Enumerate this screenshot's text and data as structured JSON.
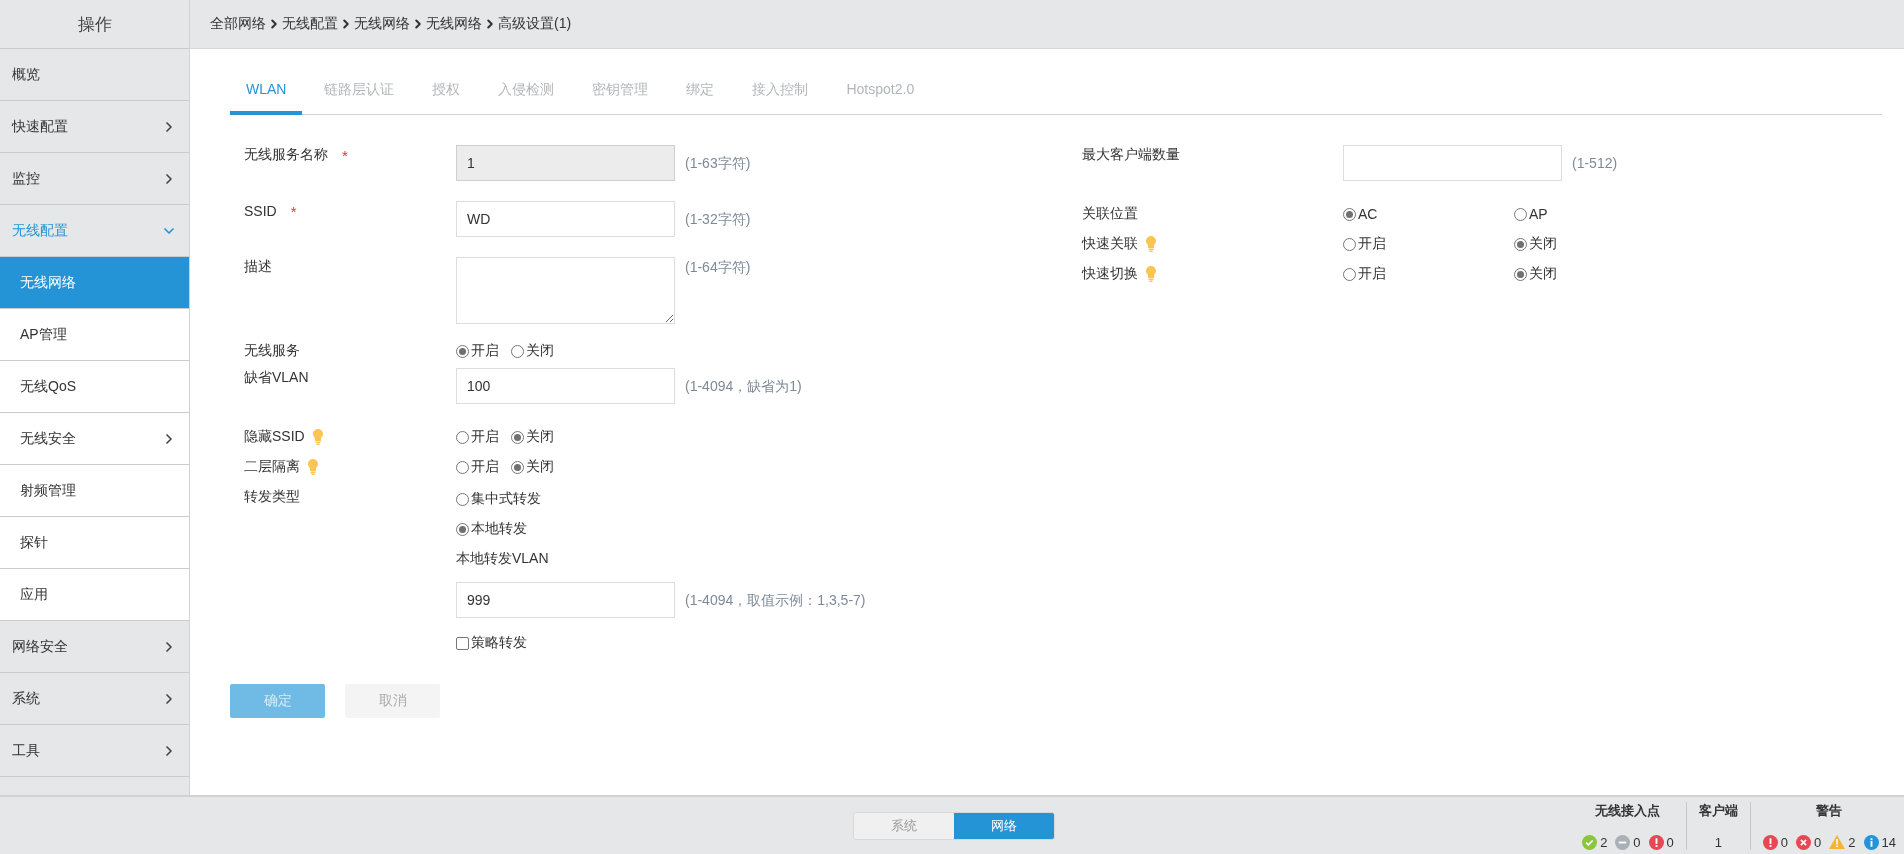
{
  "sidebar": {
    "title": "操作",
    "items": [
      {
        "label": "概览",
        "expandable": false,
        "expanded": false,
        "selected": false
      },
      {
        "label": "快速配置",
        "expandable": true,
        "expanded": false,
        "selected": false
      },
      {
        "label": "监控",
        "expandable": true,
        "expanded": false,
        "selected": false
      },
      {
        "label": "无线配置",
        "expandable": true,
        "expanded": true,
        "selected": false,
        "children": [
          {
            "label": "无线网络",
            "expandable": false,
            "expanded": false,
            "selected": true
          },
          {
            "label": "AP管理",
            "expandable": false,
            "expanded": false,
            "selected": false
          },
          {
            "label": "无线QoS",
            "expandable": false,
            "expanded": false,
            "selected": false
          },
          {
            "label": "无线安全",
            "expandable": true,
            "expanded": false,
            "selected": false
          },
          {
            "label": "射频管理",
            "expandable": false,
            "expanded": false,
            "selected": false
          },
          {
            "label": "探针",
            "expandable": false,
            "expanded": false,
            "selected": false
          },
          {
            "label": "应用",
            "expandable": false,
            "expanded": false,
            "selected": false
          }
        ]
      },
      {
        "label": "网络安全",
        "expandable": true,
        "expanded": false,
        "selected": false
      },
      {
        "label": "系统",
        "expandable": true,
        "expanded": false,
        "selected": false
      },
      {
        "label": "工具",
        "expandable": true,
        "expanded": false,
        "selected": false
      }
    ]
  },
  "breadcrumb": [
    "全部网络",
    "无线配置",
    "无线网络",
    "无线网络",
    "高级设置(1)"
  ],
  "tabs": [
    {
      "label": "WLAN",
      "selected": true
    },
    {
      "label": "链路层认证",
      "selected": false
    },
    {
      "label": "授权",
      "selected": false
    },
    {
      "label": "入侵检测",
      "selected": false
    },
    {
      "label": "密钥管理",
      "selected": false
    },
    {
      "label": "绑定",
      "selected": false
    },
    {
      "label": "接入控制",
      "selected": false
    },
    {
      "label": "Hotspot2.0",
      "selected": false
    }
  ],
  "left_fields": [
    {
      "kind": "input",
      "label": "无线服务名称",
      "required_mark": "*",
      "readonly": true,
      "value": "1",
      "hint": "(1-63字符)"
    },
    {
      "kind": "input",
      "label": "SSID",
      "required_mark": "*",
      "readonly": false,
      "value": "WD",
      "hint": "(1-32字符)"
    },
    {
      "kind": "textarea",
      "label": "描述",
      "hint": "(1-64字符)"
    },
    {
      "kind": "radio",
      "label": "无线服务",
      "tip": false,
      "options": [
        {
          "label": "开启",
          "selected": true
        },
        {
          "label": "关闭",
          "selected": false
        }
      ]
    },
    {
      "kind": "input",
      "label": "缺省VLAN",
      "readonly": false,
      "value": "100",
      "hint": "(1-4094，缺省为1)"
    },
    {
      "kind": "radio",
      "label": "隐藏SSID",
      "tip": true,
      "options": [
        {
          "label": "开启",
          "selected": false
        },
        {
          "label": "关闭",
          "selected": true
        }
      ]
    },
    {
      "kind": "radio",
      "label": "二层隔离",
      "tip": true,
      "options": [
        {
          "label": "开启",
          "selected": false
        },
        {
          "label": "关闭",
          "selected": true
        }
      ]
    },
    {
      "kind": "forwarding",
      "label": "转发类型",
      "options": [
        {
          "label": "集中式转发",
          "selected": false
        },
        {
          "label": "本地转发",
          "selected": true
        }
      ],
      "vlan_label": "本地转发VLAN",
      "vlan_value": "999",
      "vlan_hint": "(1-4094，取值示例：1,3,5-7)",
      "policy": {
        "label": "策略转发",
        "checked": false
      }
    }
  ],
  "right_fields": [
    {
      "kind": "input",
      "label": "最大客户端数量",
      "readonly": false,
      "hint": "(1-512)"
    },
    {
      "kind": "radio",
      "label": "关联位置",
      "tip": false,
      "options": [
        {
          "label": "AC",
          "selected": true
        },
        {
          "label": "AP",
          "selected": false
        }
      ]
    },
    {
      "kind": "radio",
      "label": "快速关联",
      "tip": true,
      "options": [
        {
          "label": "开启",
          "selected": false
        },
        {
          "label": "关闭",
          "selected": true
        }
      ]
    },
    {
      "kind": "radio",
      "label": "快速切换",
      "tip": true,
      "options": [
        {
          "label": "开启",
          "selected": false
        },
        {
          "label": "关闭",
          "selected": true
        }
      ]
    }
  ],
  "buttons": [
    {
      "label": "确定",
      "kind": "primary"
    },
    {
      "label": "取消",
      "kind": "secondary"
    }
  ],
  "footer": {
    "toggle": [
      {
        "label": "系统",
        "selected": false
      },
      {
        "label": "网络",
        "selected": true
      }
    ],
    "groups": [
      {
        "title": "无线接入点",
        "items": [
          {
            "kind": "ok",
            "text": "2"
          },
          {
            "kind": "offline",
            "text": "0"
          },
          {
            "kind": "error",
            "text": "0"
          }
        ]
      },
      {
        "title": "客户端",
        "items": [
          {
            "kind": "plain",
            "text": "1"
          }
        ]
      },
      {
        "title": "警告",
        "items": [
          {
            "kind": "error",
            "text": "0"
          },
          {
            "kind": "critical",
            "text": "0"
          },
          {
            "kind": "warning",
            "text": "2"
          },
          {
            "kind": "info",
            "text": "14"
          }
        ]
      }
    ]
  }
}
